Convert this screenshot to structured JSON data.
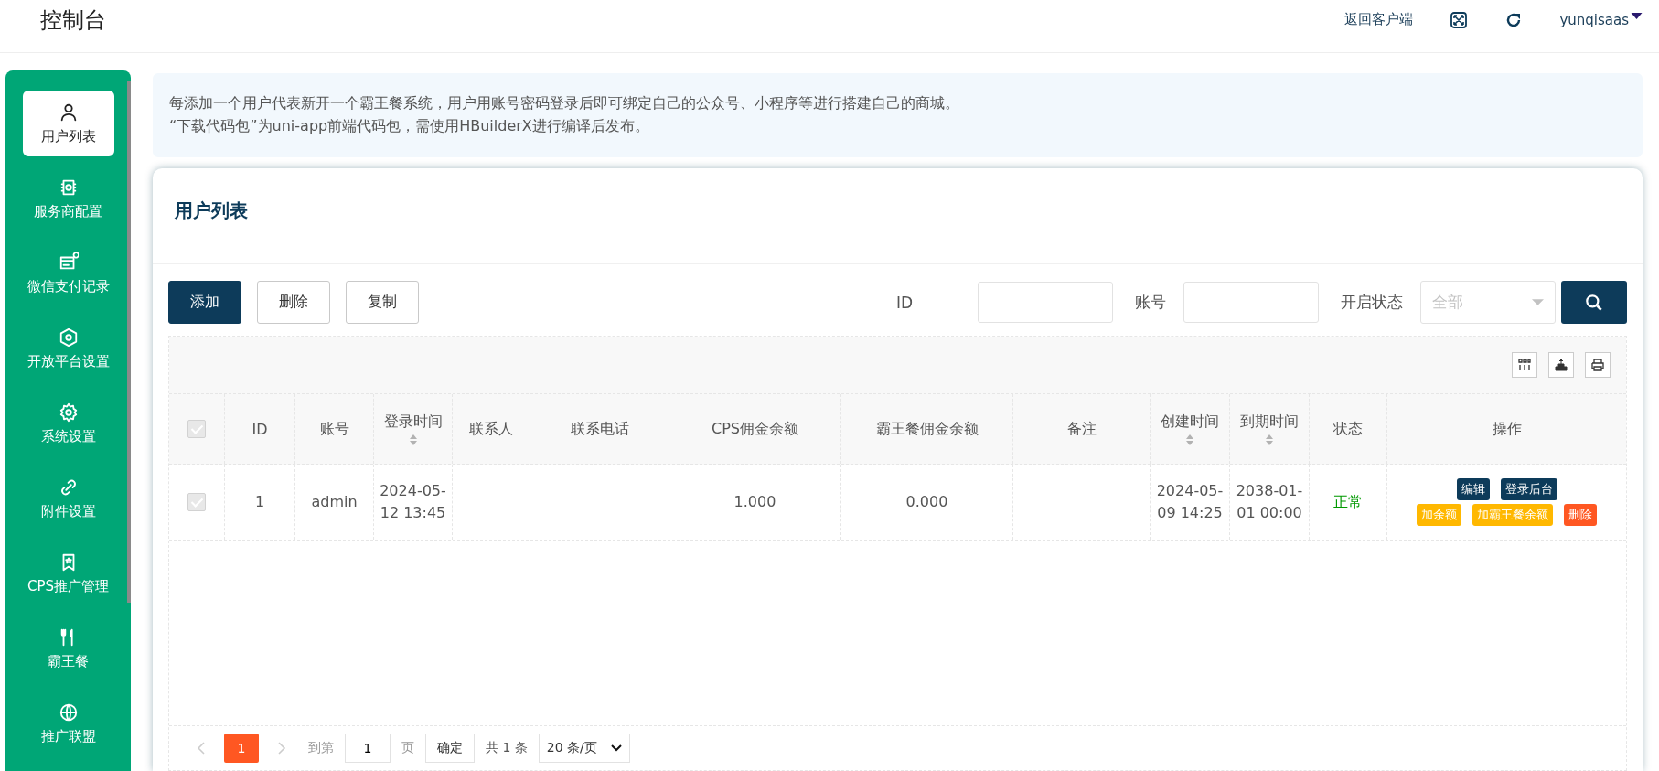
{
  "header": {
    "title": "控制台",
    "back_link": "返回客户端",
    "user": "yunqisaas"
  },
  "sidebar": {
    "items": [
      {
        "label": "用户列表",
        "selected": true
      },
      {
        "label": "服务商配置",
        "selected": false
      },
      {
        "label": "微信支付记录",
        "selected": false
      },
      {
        "label": "开放平台设置",
        "selected": false
      },
      {
        "label": "系统设置",
        "selected": false
      },
      {
        "label": "附件设置",
        "selected": false
      },
      {
        "label": "CPS推广管理",
        "selected": false
      },
      {
        "label": "霸王餐",
        "selected": false
      },
      {
        "label": "推广联盟",
        "selected": false
      }
    ]
  },
  "notice": [
    "每添加一个用户代表新开一个霸王餐系统，用户用账号密码登录后即可绑定自己的公众号、小程序等进行搭建自己的商城。",
    "“下载代码包”为uni-app前端代码包，需使用HBuilderX进行编译后发布。"
  ],
  "card": {
    "title": "用户列表",
    "buttons": [
      {
        "label": "添加",
        "kind": "primary"
      },
      {
        "label": "删除",
        "kind": "plain"
      },
      {
        "label": "复制",
        "kind": "plain"
      }
    ],
    "filters": [
      {
        "label": "ID",
        "kind": "input"
      },
      {
        "label": "账号",
        "kind": "input"
      },
      {
        "label": "开启状态",
        "kind": "select",
        "placeholder": "全部"
      }
    ],
    "table": {
      "header_checkbox": {
        "checked": false,
        "disabled": true
      },
      "columns": [
        {
          "label": "ID",
          "sortable": false
        },
        {
          "label": "账号",
          "sortable": false
        },
        {
          "label": "登录时间",
          "sortable": true
        },
        {
          "label": "联系人",
          "sortable": false
        },
        {
          "label": "联系电话",
          "sortable": false
        },
        {
          "label": "CPS佣金余额",
          "sortable": false
        },
        {
          "label": "霸王餐佣金余额",
          "sortable": false
        },
        {
          "label": "备注",
          "sortable": false
        },
        {
          "label": "创建时间",
          "sortable": true
        },
        {
          "label": "到期时间",
          "sortable": true
        },
        {
          "label": "状态",
          "sortable": false
        },
        {
          "label": "操作",
          "sortable": false
        }
      ],
      "rows": [
        {
          "checked": false,
          "disabled": true,
          "cells": [
            "1",
            "admin",
            "2024-05-12 13:45",
            "",
            "",
            "1.000",
            "0.000",
            "",
            "2024-05-09 14:25",
            "2038-01-01 00:00"
          ],
          "status": {
            "text": "正常",
            "kind": "ok"
          },
          "actions": [
            [
              {
                "label": "编辑",
                "kind": "dark"
              },
              {
                "label": "登录后台",
                "kind": "dark"
              }
            ],
            [
              {
                "label": "加余额",
                "kind": "warn"
              },
              {
                "label": "加霸王餐余额",
                "kind": "warn"
              },
              {
                "label": "删除",
                "kind": "danger"
              }
            ]
          ]
        }
      ]
    },
    "pagination": {
      "pages": [
        {
          "label": "1",
          "selected": true
        }
      ],
      "goto_label": "到第",
      "goto_value": "1",
      "page_unit": "页",
      "confirm": "确定",
      "total": "共 1 条",
      "page_size": "20 条/页"
    }
  }
}
